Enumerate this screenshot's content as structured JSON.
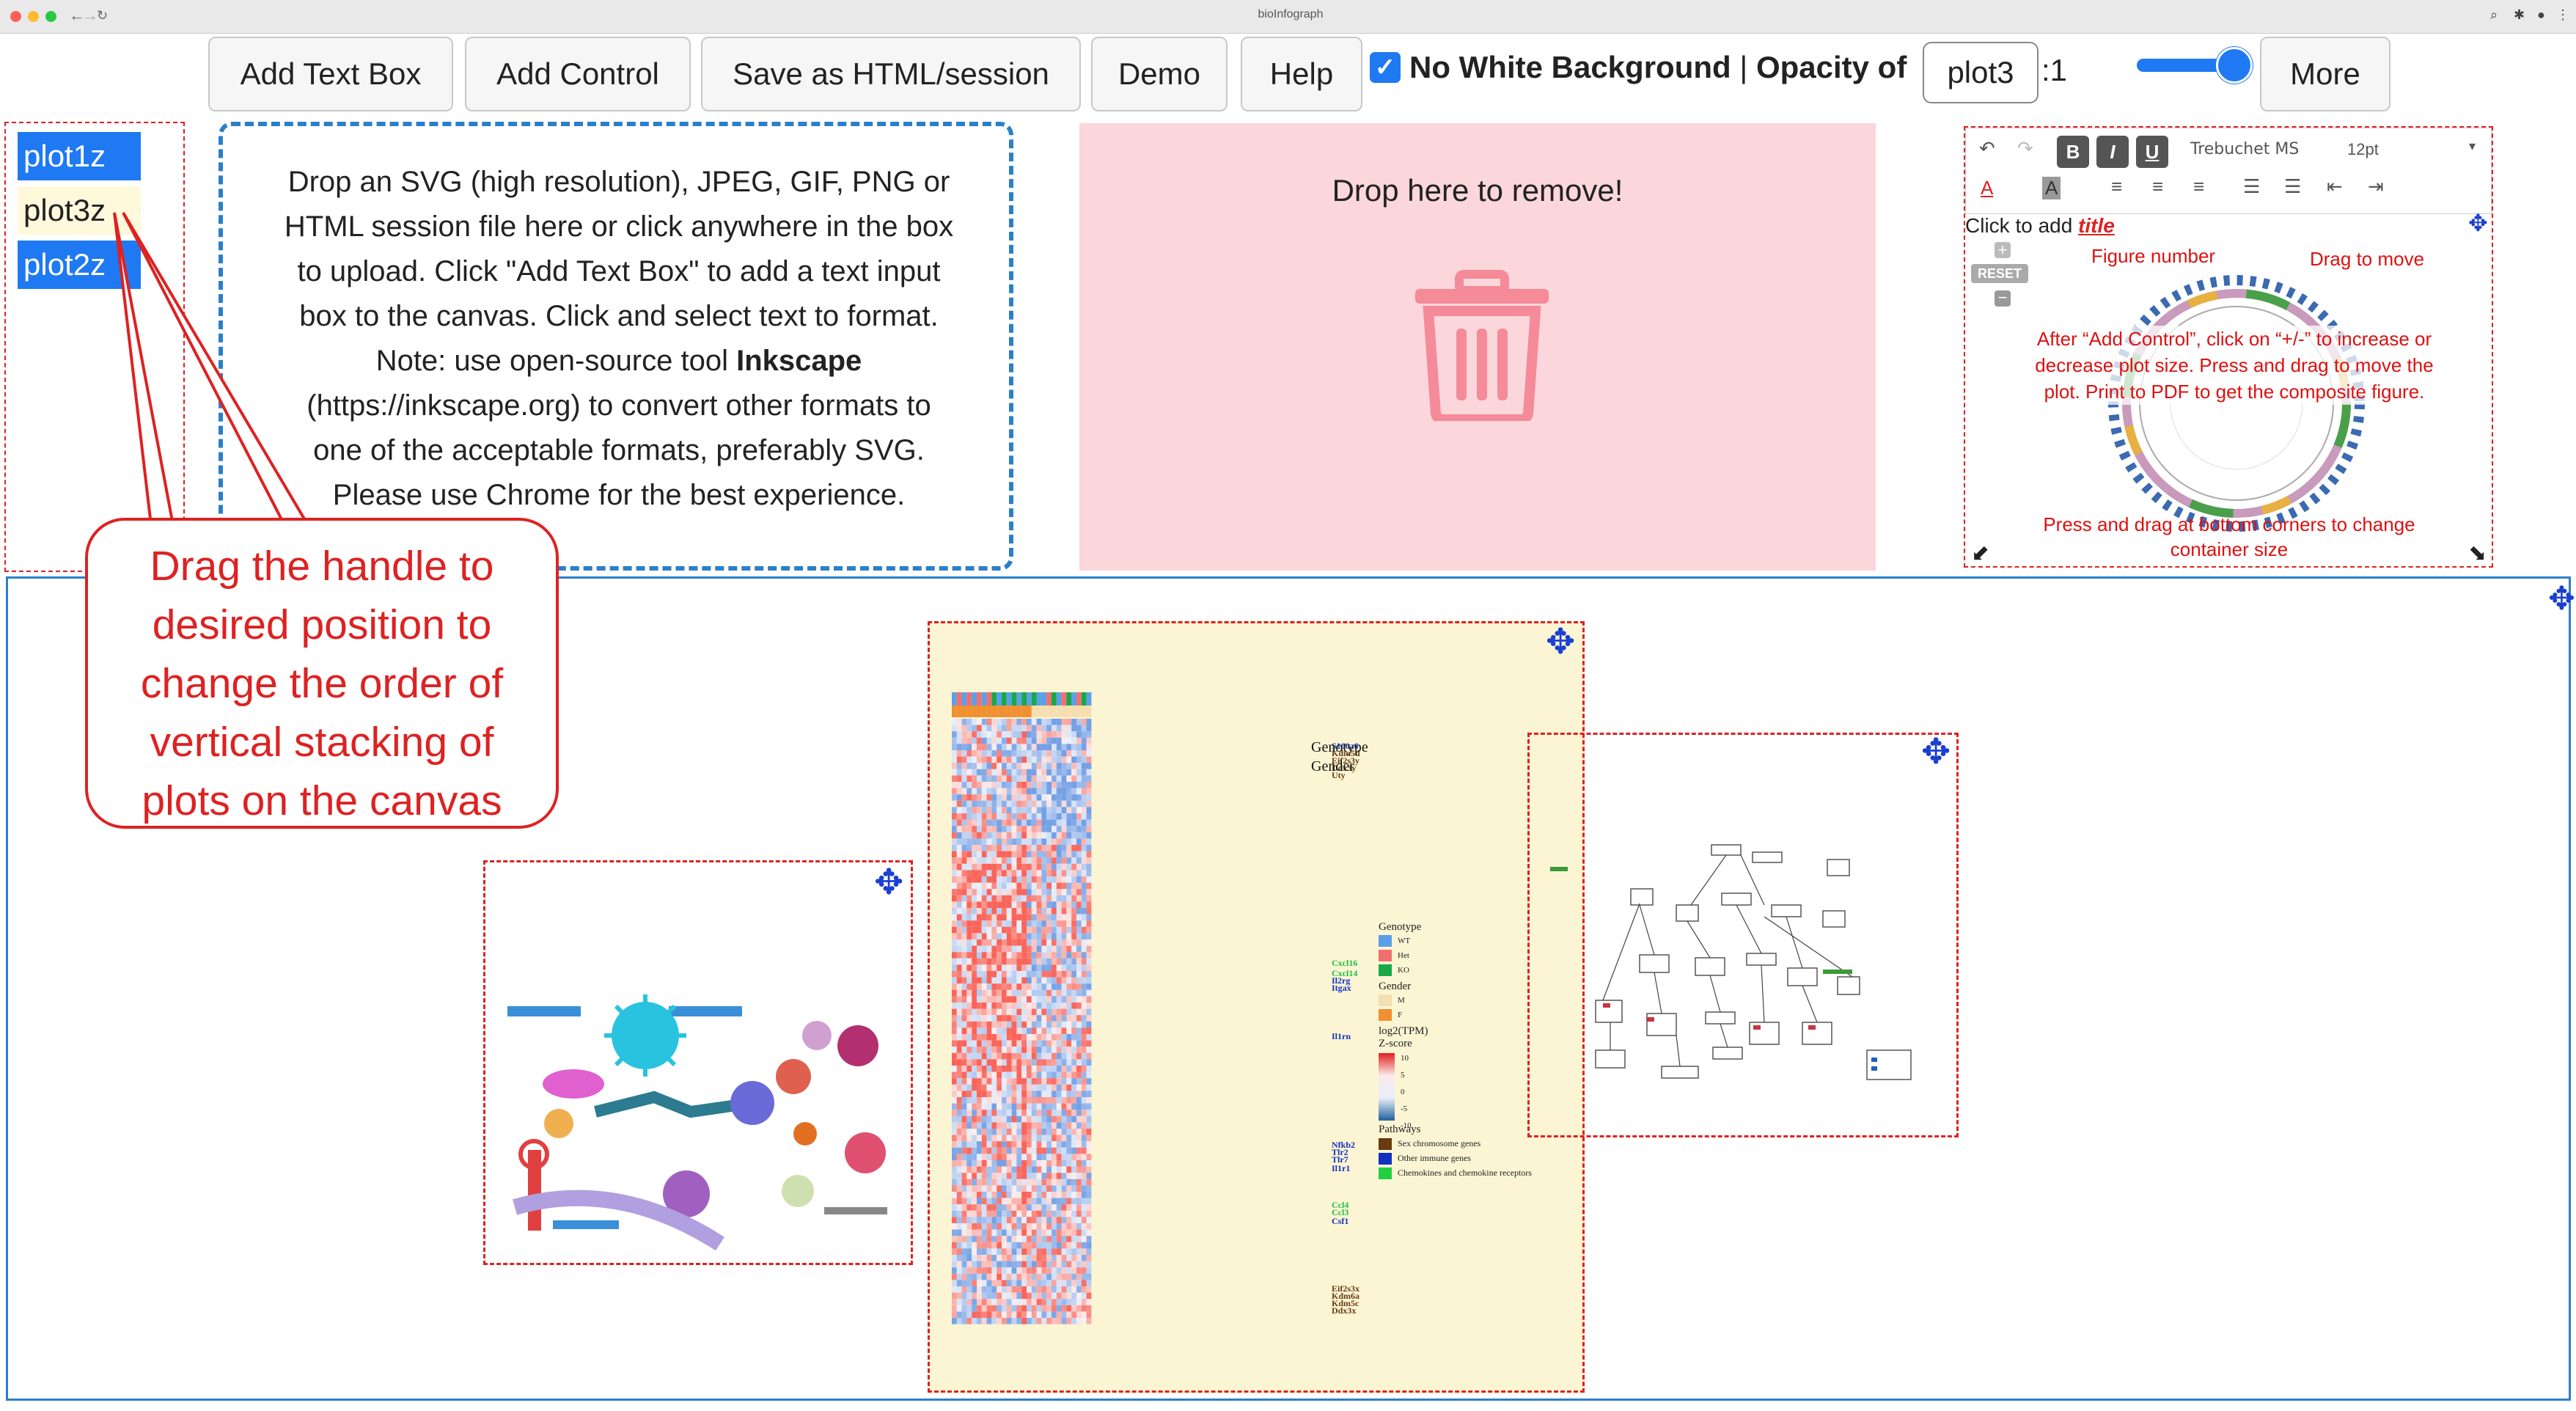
{
  "browser": {
    "title": "bioInfograph"
  },
  "toolbar": {
    "add_text_box": "Add Text Box",
    "add_control": "Add Control",
    "save": "Save as HTML/session",
    "demo": "Demo",
    "help": "Help",
    "no_white_bg": "No White Background",
    "separator": "|",
    "opacity_label": "Opacity of",
    "opacity_target": "plot3",
    "ratio": ":1",
    "more": "More",
    "no_white_bg_checked": true
  },
  "plot_list": [
    {
      "label": "plot1z",
      "selected": true
    },
    {
      "label": "plot3z",
      "selected": false
    },
    {
      "label": "plot2z",
      "selected": true
    }
  ],
  "dropzone": {
    "line1": "Drop an SVG (high resolution), JPEG, GIF, PNG or",
    "line2": "HTML session file here or click anywhere in the box",
    "line3": "to upload. Click \"Add Text Box\" to add a text input",
    "line4": "box to the canvas. Click and select text to format.",
    "line5a": "Note: use open-source tool ",
    "line5b": "Inkscape",
    "line6": "(https://inkscape.org) to convert other formats to",
    "line7": "one of the acceptable formats, preferably SVG.",
    "line8": "Please use Chrome for the best experience."
  },
  "removezone": {
    "label": "Drop here to remove!"
  },
  "editor": {
    "font": "Trebuchet MS",
    "size": "12pt",
    "title_prefix": "Click to add ",
    "title_word": "title",
    "reset": "RESET",
    "fig_number": "Figure number",
    "drag_move": "Drag to move",
    "after_control_1": "After “Add Control”, click on “+/-” to increase or",
    "after_control_2": "decrease plot size. Press and drag to move the",
    "after_control_3": "plot. Print to PDF to get the composite figure.",
    "corner_1": "Press and drag at bottom corners to change",
    "corner_2": "container size"
  },
  "callout": {
    "l1": "Drag the handle to",
    "l2": "desired position to",
    "l3": "change the order of",
    "l4": "vertical stacking of",
    "l5": "plots on the canvas"
  },
  "heatmap": {
    "legend_genotype": "Genotype",
    "legend_gender": "Gender",
    "genotype_items": [
      "WT",
      "Het",
      "KO"
    ],
    "gender_items": [
      "M",
      "F"
    ],
    "zscore_title": "log2(TPM)",
    "zscore_sub": "Z-score",
    "zscore_ticks": [
      "10",
      "5",
      "0",
      "-5",
      "-10"
    ],
    "pathways_title": "Pathways",
    "pathways": [
      "Sex chromosome genes",
      "Other immune genes",
      "Chemokines and chemokine receptors"
    ],
    "genes": [
      "S100a6",
      "Kdm5d",
      "Eif2s3y",
      "Ddx3y",
      "Uty",
      "Cxcl16",
      "Cxcl14",
      "Il2rg",
      "Itgax",
      "Il1rn",
      "Nfkb2",
      "Tlr2",
      "Tlr7",
      "Il1r1",
      "Ccl4",
      "Ccl3",
      "Csf1",
      "Eif2s3x",
      "Kdm6a",
      "Kdm5c",
      "Ddx3x"
    ]
  },
  "colors": {
    "accent": "#1e79f2",
    "danger": "#dd2222",
    "remove_bg": "#fbd6da",
    "dropzone_border": "#2b7fc9",
    "heatmap_bg": "#fbf5d4"
  }
}
